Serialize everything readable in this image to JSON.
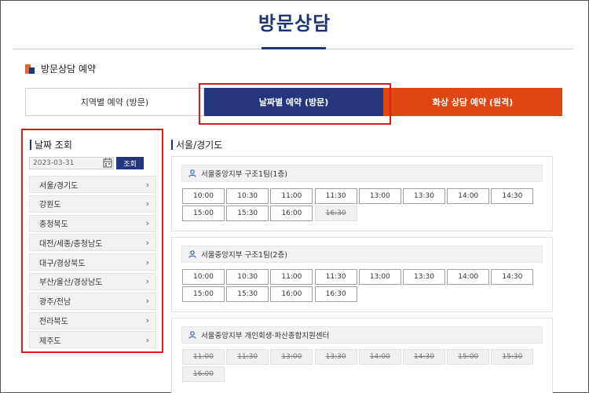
{
  "page": {
    "title": "방문상담"
  },
  "section": {
    "title": "방문상담 예약"
  },
  "tabs": [
    {
      "label": "지역별 예약 (방문)"
    },
    {
      "label": "날짜별 예약 (방문)"
    },
    {
      "label": "화상 상담 예약 (원격)"
    }
  ],
  "sidebar": {
    "title": "날짜 조회",
    "date_value": "2023-03-31",
    "search_label": "조회",
    "regions": [
      {
        "label": "서울/경기도"
      },
      {
        "label": "강원도"
      },
      {
        "label": "충청북도"
      },
      {
        "label": "대전/세종/충청남도"
      },
      {
        "label": "대구/경상북도"
      },
      {
        "label": "부산/울산/경상남도"
      },
      {
        "label": "광주/전남"
      },
      {
        "label": "전라북도"
      },
      {
        "label": "제주도"
      }
    ]
  },
  "main": {
    "region_title": "서울/경기도",
    "panels": [
      {
        "title": "서울중앙지부 구조1팀(1층)",
        "slots": [
          {
            "time": "10:00",
            "available": true
          },
          {
            "time": "10:30",
            "available": true
          },
          {
            "time": "11:00",
            "available": true
          },
          {
            "time": "11:30",
            "available": true
          },
          {
            "time": "13:00",
            "available": true
          },
          {
            "time": "13:30",
            "available": true
          },
          {
            "time": "14:00",
            "available": true
          },
          {
            "time": "14:30",
            "available": true
          },
          {
            "time": "15:00",
            "available": true
          },
          {
            "time": "15:30",
            "available": true
          },
          {
            "time": "16:00",
            "available": true
          },
          {
            "time": "16:30",
            "available": false
          }
        ]
      },
      {
        "title": "서울중앙지부 구조1팀(2층)",
        "slots": [
          {
            "time": "10:00",
            "available": true
          },
          {
            "time": "10:30",
            "available": true
          },
          {
            "time": "11:00",
            "available": true
          },
          {
            "time": "11:30",
            "available": true
          },
          {
            "time": "13:00",
            "available": true
          },
          {
            "time": "13:30",
            "available": true
          },
          {
            "time": "14:00",
            "available": true
          },
          {
            "time": "14:30",
            "available": true
          },
          {
            "time": "15:00",
            "available": true
          },
          {
            "time": "15:30",
            "available": true
          },
          {
            "time": "16:00",
            "available": true
          },
          {
            "time": "16:30",
            "available": true
          }
        ]
      },
      {
        "title": "서울중앙지부 개인회생·파산종합지원센터",
        "slots": [
          {
            "time": "11:00",
            "available": false
          },
          {
            "time": "11:30",
            "available": false
          },
          {
            "time": "13:00",
            "available": false
          },
          {
            "time": "13:30",
            "available": false
          },
          {
            "time": "14:00",
            "available": false
          },
          {
            "time": "14:30",
            "available": false
          },
          {
            "time": "15:00",
            "available": false
          },
          {
            "time": "15:30",
            "available": false
          },
          {
            "time": "16:00",
            "available": false
          }
        ]
      }
    ]
  },
  "colors": {
    "navy": "#26367e",
    "orange": "#e04514",
    "highlight": "#e01a1a"
  },
  "icons": {
    "calendar": "calendar-icon",
    "person": "person-icon",
    "chevron": "chevron-right-icon"
  }
}
